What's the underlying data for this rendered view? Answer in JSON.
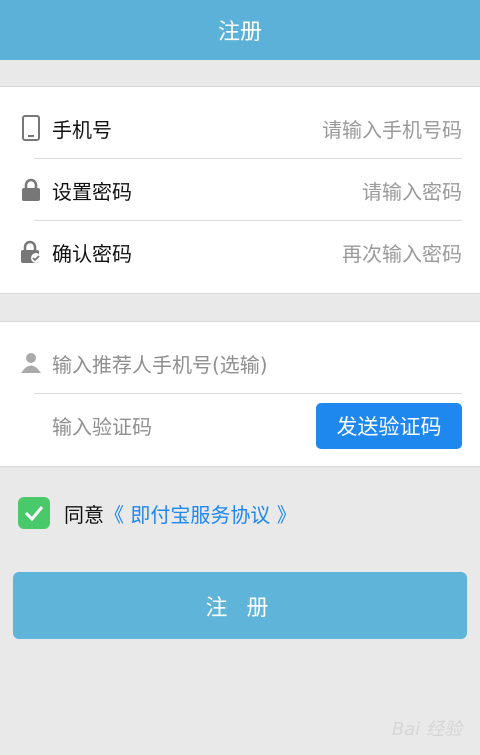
{
  "header": {
    "title": "注册"
  },
  "form": {
    "phone": {
      "label": "手机号",
      "placeholder": "请输入手机号码"
    },
    "password": {
      "label": "设置密码",
      "placeholder": "请输入密码"
    },
    "confirm": {
      "label": "确认密码",
      "placeholder": "再次输入密码"
    },
    "referrer": {
      "placeholder": "输入推荐人手机号(选输)"
    },
    "code": {
      "placeholder": "输入验证码",
      "send_label": "发送验证码"
    }
  },
  "agreement": {
    "prefix": "同意",
    "link": "《 即付宝服务协议 》",
    "checked": true
  },
  "submit_label": "注 册",
  "watermark": "Bai 经验",
  "colors": {
    "header": "#5cb1d8",
    "accent": "#1e88ee",
    "check": "#49c96a",
    "submit": "#5fb4da"
  }
}
